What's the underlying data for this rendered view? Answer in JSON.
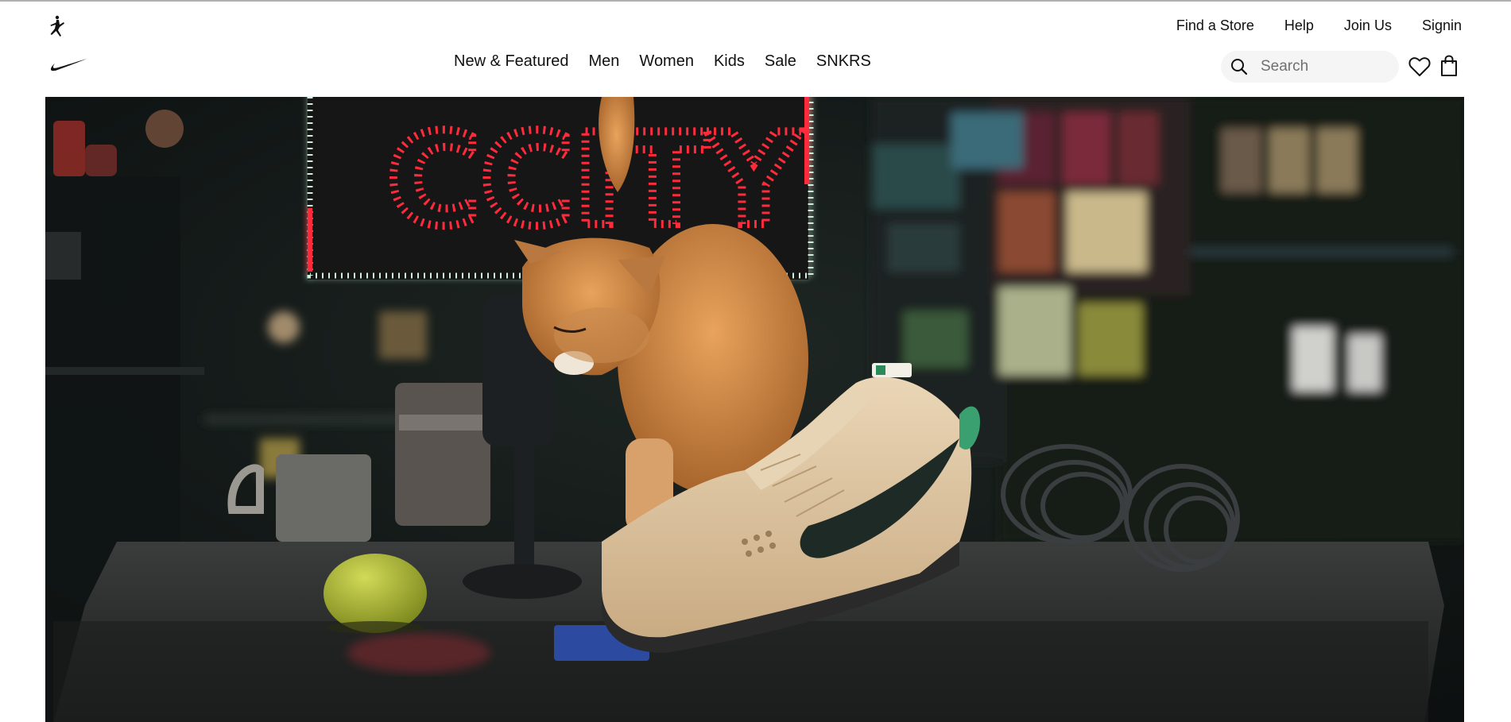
{
  "brand": {
    "jordan_logo": "jordan-jumpman-icon",
    "nike_logo": "nike-swoosh-icon"
  },
  "utility_nav": {
    "links": [
      {
        "label": "Find a Store"
      },
      {
        "label": "Help"
      },
      {
        "label": "Join Us"
      },
      {
        "label": "Signin"
      }
    ]
  },
  "main_nav": {
    "items": [
      {
        "label": "New & Featured"
      },
      {
        "label": "Men"
      },
      {
        "label": "Women"
      },
      {
        "label": "Kids"
      },
      {
        "label": "Sale"
      },
      {
        "label": "SNKRS"
      }
    ]
  },
  "search": {
    "placeholder": "Search",
    "value": "",
    "icon": "search-icon"
  },
  "actions": {
    "favorites_icon": "heart-icon",
    "bag_icon": "shopping-bag-icon"
  },
  "hero": {
    "sign_text": "CCITY",
    "colors": {
      "neon_red": "#ff2a3a",
      "neon_green": "#9fffc8",
      "cat_orange": "#d98a3e",
      "shoe_beige": "#d9c2a0",
      "swoosh_dark": "#1e2a26",
      "lime": "#b8c23a",
      "background_dark": "#111716"
    }
  }
}
